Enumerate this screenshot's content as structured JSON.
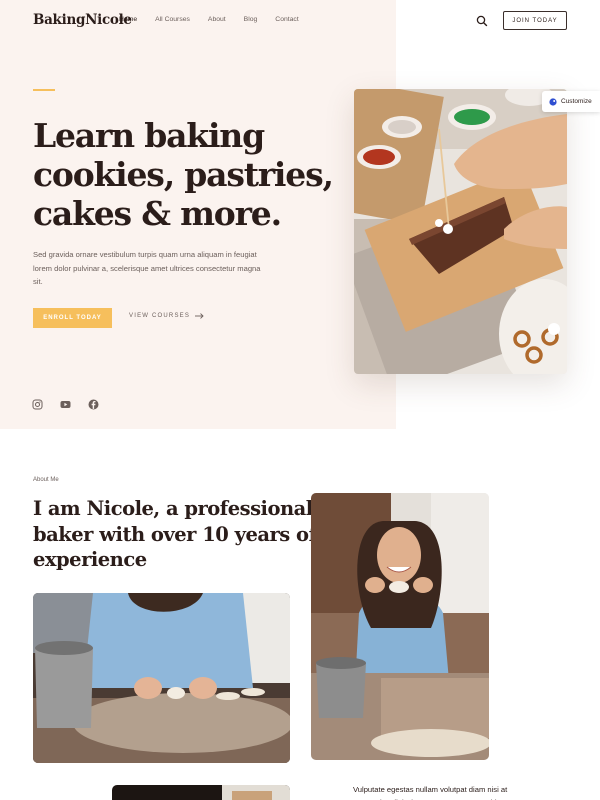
{
  "header": {
    "logo": "BakingNicole",
    "nav": [
      "Home",
      "All Courses",
      "About",
      "Blog",
      "Contact"
    ],
    "join_label": "JOIN TODAY",
    "search_icon": "search-icon"
  },
  "hero": {
    "title_lines": [
      "Learn baking",
      "cookies, pastries,",
      "cakes & more."
    ],
    "description": "Sed gravida ornare vestibulum turpis quam urna aliquam in feugiat lorem dolor pulvinar a, scelerisque amet ultrices consectetur magna sit.",
    "enroll_label": "ENROLL TODAY",
    "view_label": "VIEW COURSES",
    "socials": [
      "instagram-icon",
      "youtube-icon",
      "facebook-icon"
    ]
  },
  "customize_label": "Customize",
  "about": {
    "label": "About Me",
    "title_lines": [
      "I am Nicole, a professional",
      "baker with over 10 years of",
      "experience"
    ],
    "text": "Vulputate egestas nullam volutpat diam nisi at venenatis adipiscing massa posuere morbi"
  },
  "colors": {
    "accent": "#f6bf5c",
    "hero_bg": "#fbf3ef",
    "text": "#2b1d1a"
  }
}
